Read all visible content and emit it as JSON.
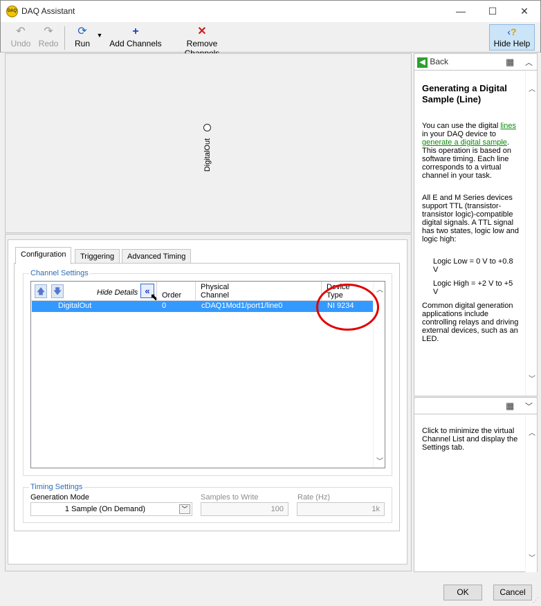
{
  "window": {
    "title": "DAQ Assistant",
    "icon": "daq-icon"
  },
  "toolbar": {
    "undo": "Undo",
    "redo": "Redo",
    "run": "Run",
    "add_channels": "Add Channels",
    "remove_channels": "Remove Channels",
    "hide_help": "Hide Help"
  },
  "canvas": {
    "channel_label": "DigitalOut"
  },
  "tabs": [
    "Configuration",
    "Triggering",
    "Advanced Timing"
  ],
  "channel_settings": {
    "group_label": "Channel Settings",
    "hide_details": "Hide Details",
    "columns": {
      "order": "Order",
      "physical_channel": "Physical Channel",
      "device_type": "Device Type"
    },
    "row": {
      "name": "DigitalOut",
      "order": "0",
      "physical_channel": "cDAQ1Mod1/port1/line0",
      "device_type": "NI 9234"
    },
    "annotation_color": "#e00000",
    "selection_color": "#3399ff"
  },
  "timing_settings": {
    "group_label": "Timing Settings",
    "generation_mode_label": "Generation Mode",
    "generation_mode_value": "1 Sample (On Demand)",
    "samples_label": "Samples to Write",
    "samples_value": "100",
    "rate_label": "Rate (Hz)",
    "rate_value": "1k"
  },
  "help": {
    "back": "Back",
    "title": "Generating a Digital Sample (Line)",
    "p1_pre": "You can use the digital",
    "p1_link1": "lines",
    "p1_mid": "in your DAQ device to",
    "p1_link2": "generate a digital sample",
    "p1_post": ". This operation is based on software timing. Each line corresponds to a virtual channel in your task.",
    "p2": "All E and M Series devices support TTL (transistor-transistor logic)-compatible digital signals. A TTL signal has two states, logic low and logic high:",
    "logic_low": "Logic Low = 0 V to +0.8 V",
    "logic_high": "Logic High = +2 V to +5 V",
    "p3": "Common digital generation applications include controlling relays and driving external devices, such as an LED.",
    "lower_text": "Click to minimize the virtual Channel List and display the Settings tab."
  },
  "footer": {
    "ok": "OK",
    "cancel": "Cancel"
  }
}
